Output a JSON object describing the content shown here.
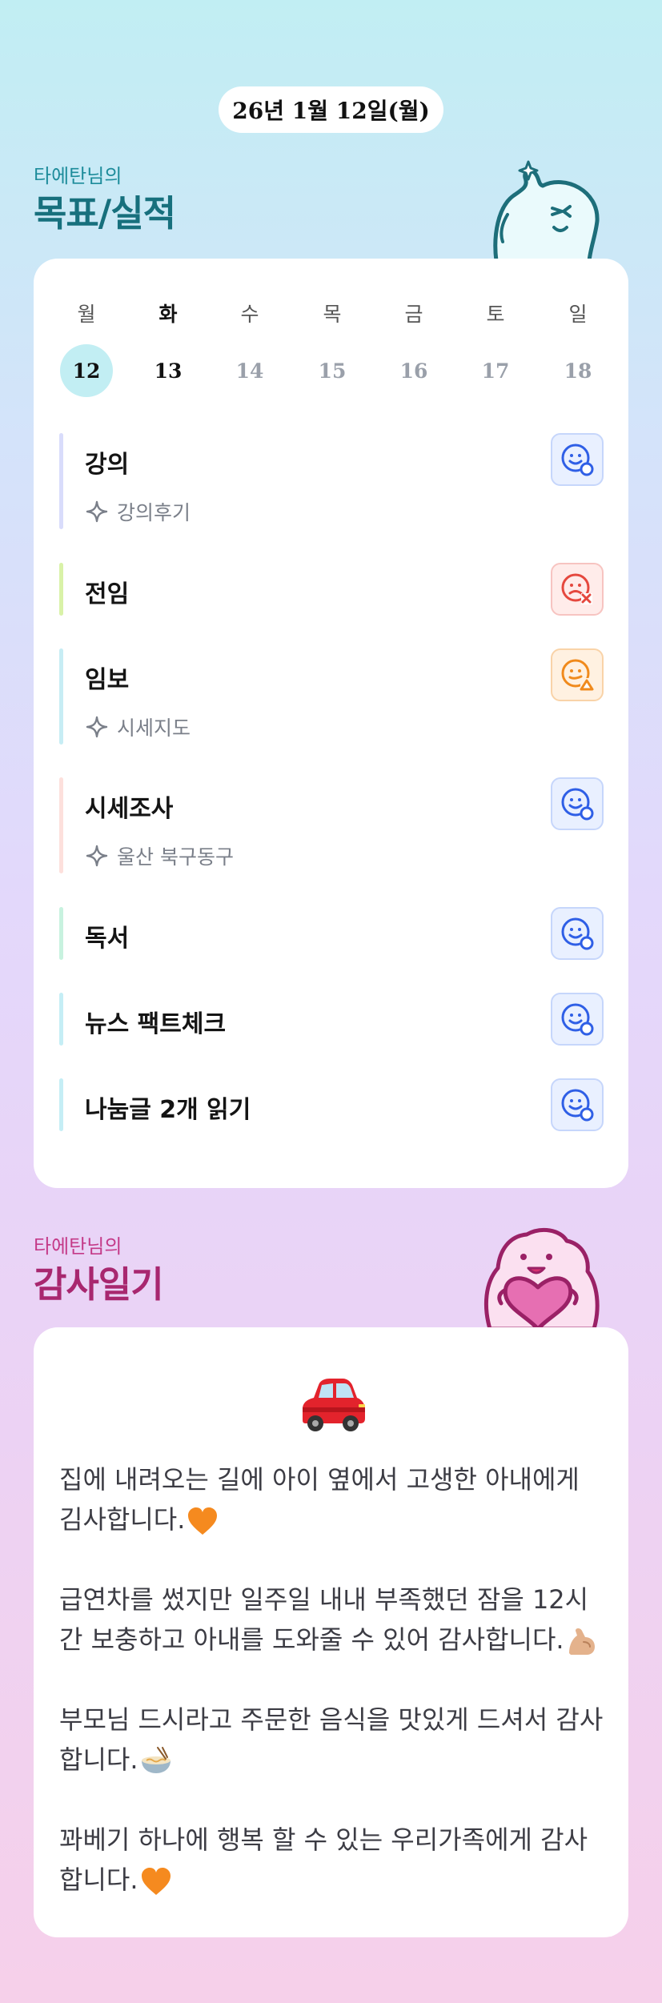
{
  "header": {
    "date": "26년 1월 12일(월)"
  },
  "goals_section": {
    "subtitle": "타에탄님의",
    "title": "목표/실적",
    "week": {
      "days": [
        "월",
        "화",
        "수",
        "목",
        "금",
        "토",
        "일"
      ],
      "dates": [
        "12",
        "13",
        "14",
        "15",
        "16",
        "17",
        "18"
      ],
      "selected_index": 0,
      "today_index": 1
    },
    "items": [
      {
        "label": "강의",
        "sub": "강의후기",
        "bar_color": "#d9dcfb",
        "status": "done",
        "status_icon": "smile-check-icon"
      },
      {
        "label": "전임",
        "sub": "",
        "bar_color": "#d9f2a8",
        "status": "fail",
        "status_icon": "sad-x-icon"
      },
      {
        "label": "임보",
        "sub": "시세지도",
        "bar_color": "#c7edf4",
        "status": "partial",
        "status_icon": "neutral-triangle-icon"
      },
      {
        "label": "시세조사",
        "sub": "울산 북구동구",
        "bar_color": "#fde0dc",
        "status": "done",
        "status_icon": "smile-check-icon"
      },
      {
        "label": "독서",
        "sub": "",
        "bar_color": "#c8f2df",
        "status": "done",
        "status_icon": "smile-check-icon"
      },
      {
        "label": "뉴스 팩트체크",
        "sub": "",
        "bar_color": "#c5eef5",
        "status": "done",
        "status_icon": "smile-check-icon"
      },
      {
        "label": "나눔글 2개 읽기",
        "sub": "",
        "bar_color": "#c5eef5",
        "status": "done",
        "status_icon": "smile-check-icon"
      }
    ],
    "status_colors": {
      "done": "#2f5fe6",
      "fail": "#e5483e",
      "partial": "#f08a1c"
    }
  },
  "gratitude_section": {
    "subtitle": "타에탄님의",
    "title": "감사일기",
    "top_emoji": "car-icon",
    "entries": [
      {
        "text": "집에 내려오는 길에 아이 옆에서 고생한 아내에게 김사합니다.",
        "emoji": "orange-heart-icon"
      },
      {
        "text": "급연차를 썼지만 일주일 내내 부족했던 잠을 12시간 보충하고 아내를 도와줄 수 있어 감사합니다.",
        "emoji": "flexed-biceps-icon"
      },
      {
        "text": "부모님 드시라고 주문한 음식을 맛있게 드셔서 감사합니다.",
        "emoji": "noodle-bowl-icon"
      },
      {
        "text": "꽈베기 하나에 행복 할 수 있는 우리가족에게 감사합니다.",
        "emoji": "orange-heart-icon"
      }
    ]
  }
}
